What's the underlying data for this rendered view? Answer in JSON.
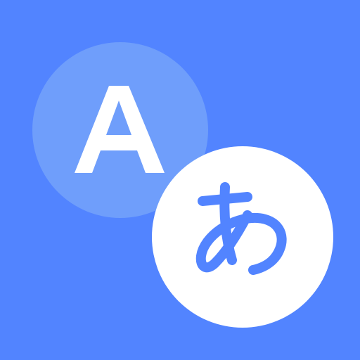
{
  "icon": {
    "name": "translate-app-icon",
    "source_language_letter": "A",
    "target_language_letter": "あ"
  },
  "colors": {
    "background": "#5284FF",
    "source_bubble": "#6F9EFB",
    "target_bubble": "#FFFFFF",
    "source_letter": "#FFFFFF",
    "target_letter": "#5284FF"
  }
}
